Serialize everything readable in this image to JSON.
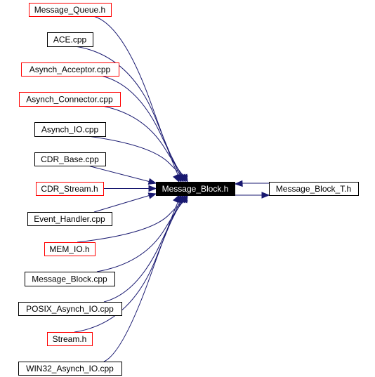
{
  "graph": {
    "center": {
      "label": "Message_Block.h",
      "fill": "#000000",
      "text_color": "#ffffff"
    },
    "includes": {
      "label": "Message_Block_T.h",
      "border": "#000000"
    },
    "includers": [
      {
        "label": "Message_Queue.h",
        "border": "#ff0000"
      },
      {
        "label": "ACE.cpp",
        "border": "#000000"
      },
      {
        "label": "Asynch_Acceptor.cpp",
        "border": "#ff0000"
      },
      {
        "label": "Asynch_Connector.cpp",
        "border": "#ff0000"
      },
      {
        "label": "Asynch_IO.cpp",
        "border": "#000000"
      },
      {
        "label": "CDR_Base.cpp",
        "border": "#000000"
      },
      {
        "label": "CDR_Stream.h",
        "border": "#ff0000"
      },
      {
        "label": "Event_Handler.cpp",
        "border": "#000000"
      },
      {
        "label": "MEM_IO.h",
        "border": "#ff0000"
      },
      {
        "label": "Message_Block.cpp",
        "border": "#000000"
      },
      {
        "label": "POSIX_Asynch_IO.cpp",
        "border": "#000000"
      },
      {
        "label": "Stream.h",
        "border": "#ff0000"
      },
      {
        "label": "WIN32_Asynch_IO.cpp",
        "border": "#000000"
      }
    ],
    "edge_color": "#191970"
  }
}
